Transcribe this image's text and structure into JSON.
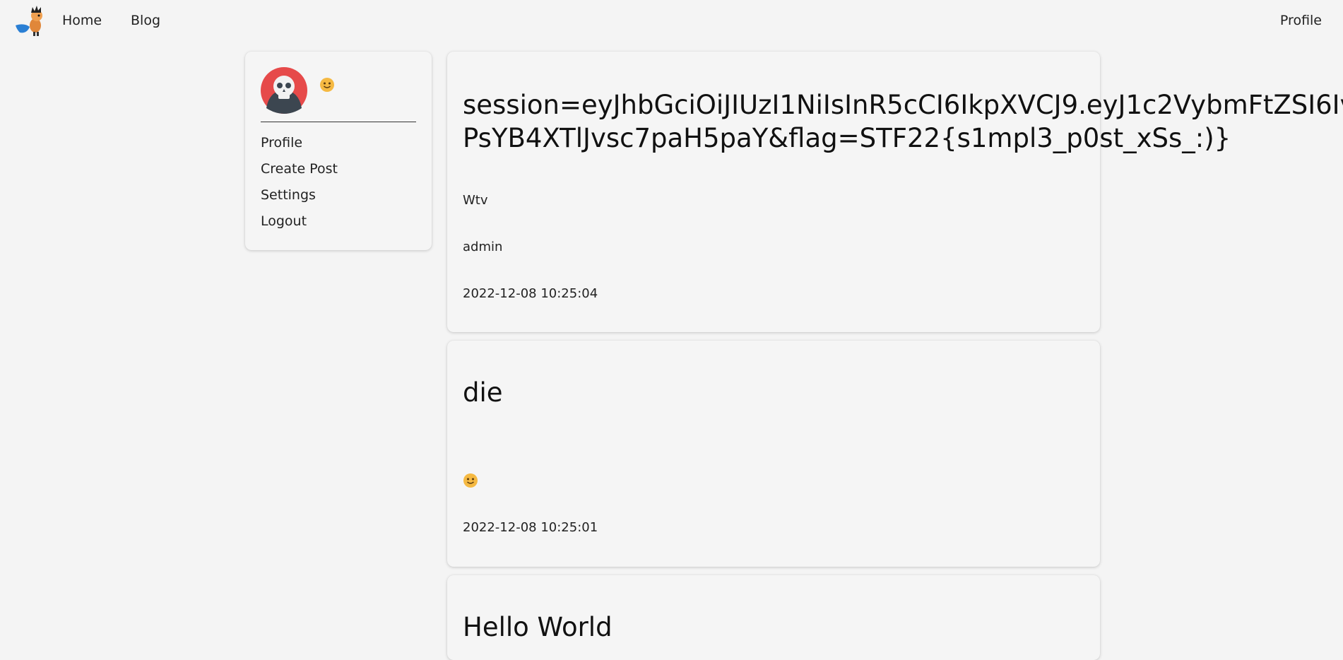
{
  "nav": {
    "home": "Home",
    "blog": "Blog",
    "profile": "Profile"
  },
  "sidebar": {
    "items": [
      {
        "label": "Profile"
      },
      {
        "label": "Create Post"
      },
      {
        "label": "Settings"
      },
      {
        "label": "Logout"
      }
    ]
  },
  "posts": [
    {
      "title": "session=eyJhbGciOiJIUzI1NiIsInR5cCI6IkpXVCJ9.eyJ1c2VybmFtZSI6Iv",
      "title_line2": "PsYB4XTlJvsc7paH5paY&flag=STF22{s1mpl3_p0st_xSs_:)}",
      "body": "Wtv",
      "author": "admin",
      "date": "2022-12-08 10:25:04"
    },
    {
      "title": "die",
      "date": "2022-12-08 10:25:01"
    },
    {
      "title": "Hello World"
    }
  ],
  "colors": {
    "background": "#f4f4f4",
    "avatar_red": "#e64a4a",
    "emoji_yellow": "#f5b942"
  }
}
